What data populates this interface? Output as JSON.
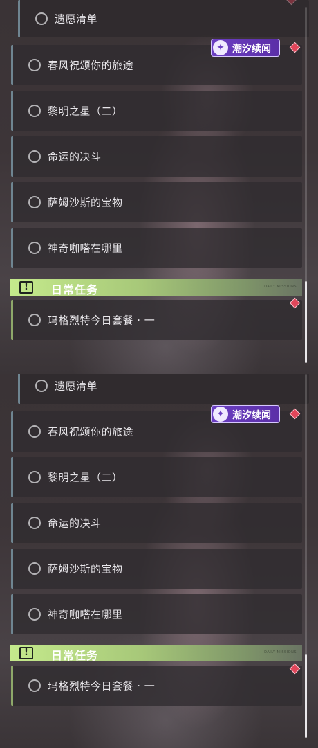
{
  "event_badge": {
    "label": "潮汐续闻",
    "icon": "sparkle-star-icon"
  },
  "quests": [
    {
      "label": "遗愿清单"
    },
    {
      "label": "春风祝颂你的旅途"
    },
    {
      "label": "黎明之星（二）"
    },
    {
      "label": "命运的决斗"
    },
    {
      "label": "萨姆沙斯的宝物"
    },
    {
      "label": "神奇咖嗒在哪里"
    }
  ],
  "daily_section": {
    "title": "日常任务",
    "icon": "exclamation-icon",
    "subtitle": "DAILY MISSIONS",
    "quest": "玛格烈特今日套餐 · 一"
  },
  "colors": {
    "quest_accent": "#6f8591",
    "daily_accent": "#a7c879",
    "event_badge": "#6b3fc2",
    "marker": "#e0465a"
  }
}
